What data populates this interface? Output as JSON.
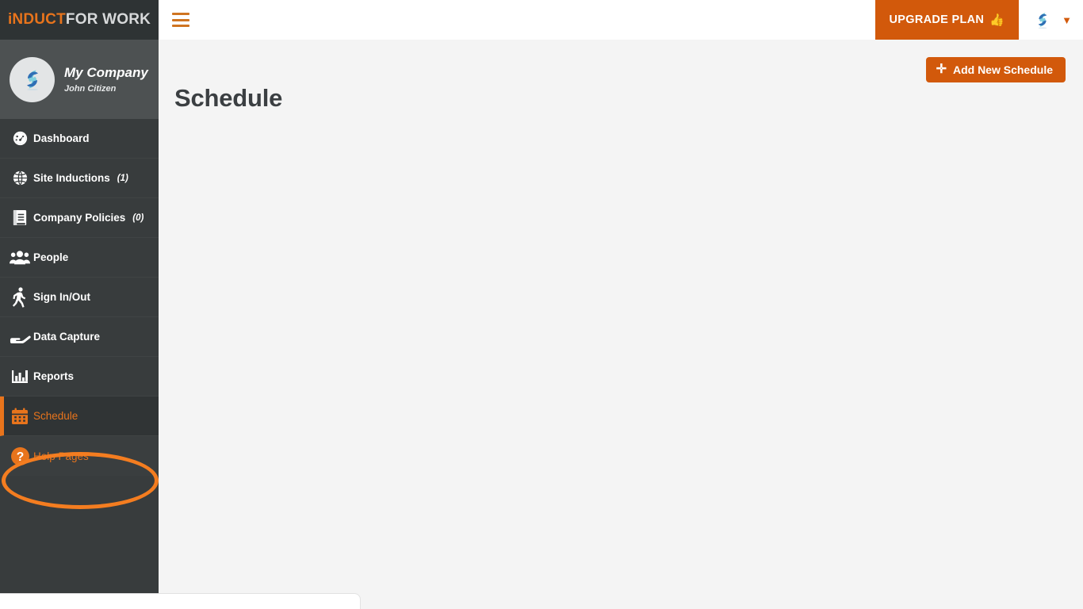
{
  "brand": {
    "name_part1": "iNDUCT",
    "name_part2": "FOR WORK"
  },
  "company": {
    "name": "My Company",
    "user": "John Citizen",
    "avatar_icon": "company-logo-icon"
  },
  "sidebar": {
    "items": [
      {
        "label": "Dashboard",
        "count": "",
        "icon": "gauge-icon",
        "name": "dashboard"
      },
      {
        "label": "Site Inductions",
        "count": "(1)",
        "icon": "globe-icon",
        "name": "site-inductions"
      },
      {
        "label": "Company Policies",
        "count": "(0)",
        "icon": "book-icon",
        "name": "company-policies"
      },
      {
        "label": "People",
        "count": "",
        "icon": "people-icon",
        "name": "people"
      },
      {
        "label": "Sign In/Out",
        "count": "",
        "icon": "walking-icon",
        "name": "sign-in-out"
      },
      {
        "label": "Data Capture",
        "count": "",
        "icon": "hand-icon",
        "name": "data-capture"
      },
      {
        "label": "Reports",
        "count": "",
        "icon": "bar-chart-icon",
        "name": "reports"
      },
      {
        "label": "Schedule",
        "count": "",
        "icon": "calendar-icon",
        "name": "schedule"
      },
      {
        "label": "Help Pages",
        "count": "",
        "icon": "question-mark-icon",
        "name": "help-pages"
      }
    ],
    "active_item": "Schedule",
    "annotated_item": "Help Pages"
  },
  "topbar": {
    "menu_toggle_icon": "hamburger-icon",
    "upgrade_label": "UPGRADE PLAN",
    "upgrade_icon": "thumbs-up-icon",
    "user_avatar_icon": "user-logo-icon",
    "caret_icon": "chevron-down-icon"
  },
  "main": {
    "page_title": "Schedule",
    "add_button_label": "Add New Schedule",
    "add_button_icon": "plus-icon"
  },
  "colors": {
    "accent_orange": "#d2590b",
    "highlight_orange": "#f47d20",
    "sidebar_bg": "#383c3d",
    "brand_bg": "#2e3334",
    "company_bg": "#4d5152",
    "content_bg": "#f4f4f4",
    "title_text": "#3b3f42"
  }
}
